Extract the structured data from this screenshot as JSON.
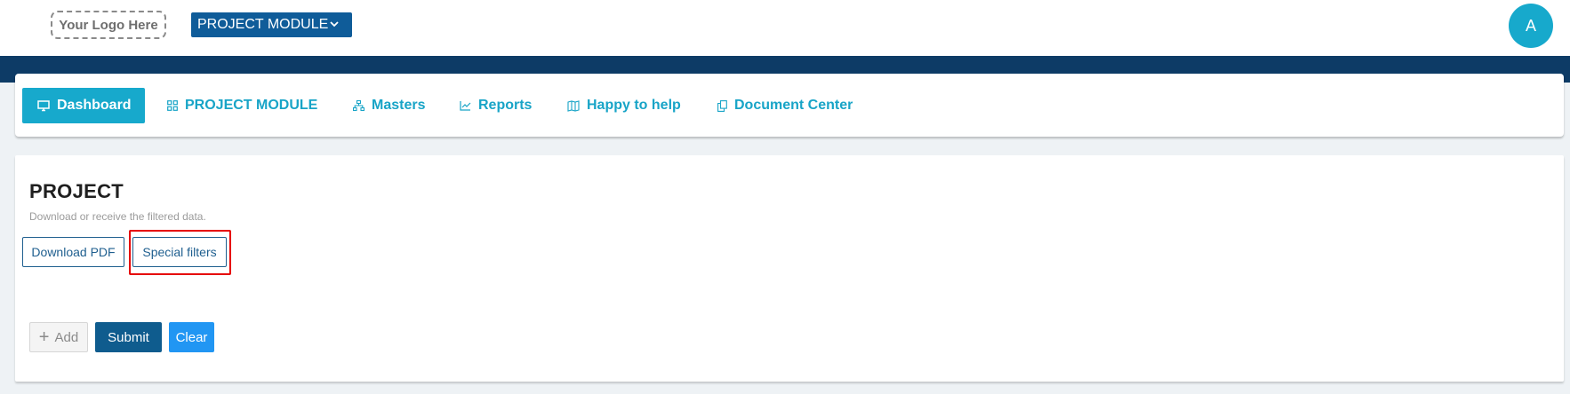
{
  "header": {
    "logo_text": "Your Logo Here",
    "module_select": "PROJECT MODULE",
    "avatar_initial": "A"
  },
  "nav": {
    "items": [
      {
        "label": "Dashboard",
        "icon": "monitor-icon",
        "active": true
      },
      {
        "label": "PROJECT MODULE",
        "icon": "grid-icon"
      },
      {
        "label": "Masters",
        "icon": "sitemap-icon"
      },
      {
        "label": "Reports",
        "icon": "line-chart-icon"
      },
      {
        "label": "Happy to help",
        "icon": "map-icon"
      },
      {
        "label": "Document Center",
        "icon": "copy-icon"
      }
    ]
  },
  "page": {
    "title": "PROJECT",
    "subtitle": "Download or receive the filtered data.",
    "download_pdf_label": "Download PDF",
    "special_filters_label": "Special filters",
    "add_label": "Add",
    "submit_label": "Submit",
    "clear_label": "Clear"
  },
  "colors": {
    "primary_dark": "#0d3b66",
    "accent": "#17a9cc",
    "highlight": "#e60000",
    "clear_blue": "#2196f3"
  }
}
